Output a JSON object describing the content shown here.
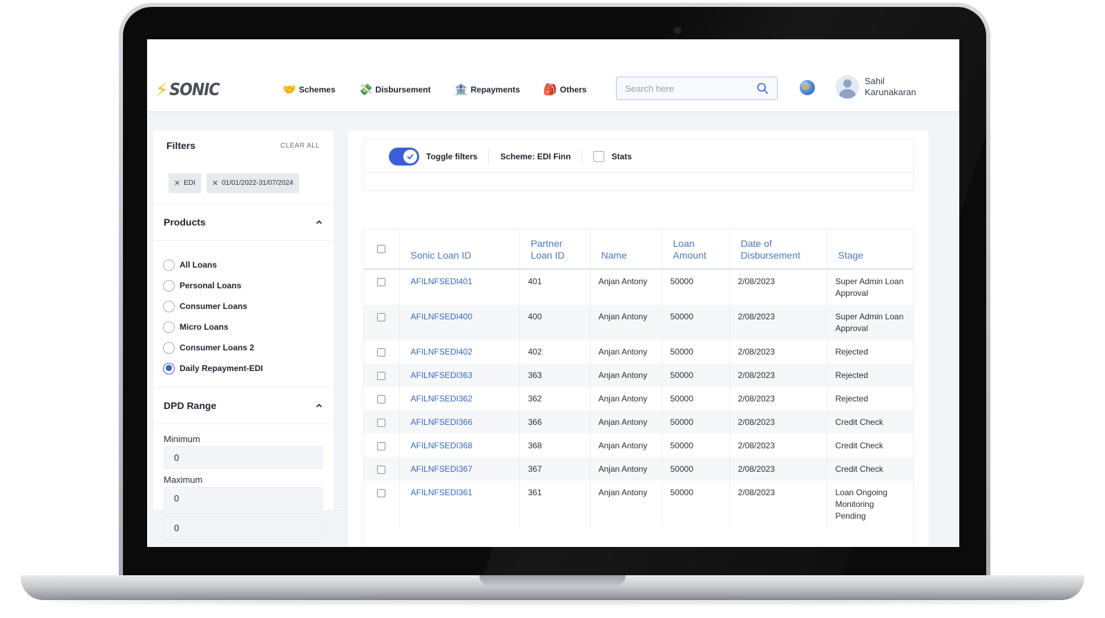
{
  "brand": {
    "name": "SONIC"
  },
  "nav": {
    "items": [
      {
        "emoji": "🤝",
        "label": "Schemes"
      },
      {
        "emoji": "💸",
        "label": "Disbursement"
      },
      {
        "emoji": "🏦",
        "label": "Repayments"
      },
      {
        "emoji": "🎒",
        "label": "Others"
      }
    ]
  },
  "search": {
    "placeholder": "Search here",
    "value": ""
  },
  "user": {
    "name": "Sahil Karunakaran"
  },
  "filters": {
    "title": "Filters",
    "clear_all": "CLEAR ALL",
    "chips": [
      "EDI",
      "01/01/2022-31/07/2024"
    ],
    "products": {
      "title": "Products",
      "options": [
        "All Loans",
        "Personal Loans",
        "Consumer Loans",
        "Micro Loans",
        "Consumer Loans 2",
        "Daily Repayment-EDI"
      ],
      "selected": "Daily Repayment-EDI"
    },
    "dpd_range": {
      "title": "DPD Range",
      "minimum_label": "Minimum",
      "minimum_value": "0",
      "maximum_label": "Maximum",
      "maximum_value": "0",
      "extra_value": "0"
    }
  },
  "toolbar": {
    "toggle_label": "Toggle filters",
    "toggle_on": true,
    "scheme_label": "Scheme: EDI Finn",
    "stats_label": "Stats",
    "stats_checked": false
  },
  "table": {
    "columns": [
      "Sonic Loan ID",
      "Partner Loan ID",
      "Name",
      "Loan Amount",
      "Date of Disbursement",
      "Stage"
    ],
    "rows": [
      {
        "sonic_id": "AFILNFSEDI401",
        "partner_id": "401",
        "name": "Anjan Antony",
        "amount": "50000",
        "date": "2/08/2023",
        "stage": "Super Admin Loan Approval"
      },
      {
        "sonic_id": "AFILNFSEDI400",
        "partner_id": "400",
        "name": "Anjan Antony",
        "amount": "50000",
        "date": "2/08/2023",
        "stage": "Super Admin Loan Approval"
      },
      {
        "sonic_id": "AFILNFSEDI402",
        "partner_id": "402",
        "name": "Anjan Antony",
        "amount": "50000",
        "date": "2/08/2023",
        "stage": "Rejected"
      },
      {
        "sonic_id": "AFILNFSEDI363",
        "partner_id": "363",
        "name": "Anjan Antony",
        "amount": "50000",
        "date": "2/08/2023",
        "stage": "Rejected"
      },
      {
        "sonic_id": "AFILNFSEDI362",
        "partner_id": "362",
        "name": "Anjan Antony",
        "amount": "50000",
        "date": "2/08/2023",
        "stage": "Rejected"
      },
      {
        "sonic_id": "AFILNFSEDI366",
        "partner_id": "366",
        "name": "Anjan Antony",
        "amount": "50000",
        "date": "2/08/2023",
        "stage": "Credit Check"
      },
      {
        "sonic_id": "AFILNFSEDI368",
        "partner_id": "368",
        "name": "Anjan Antony",
        "amount": "50000",
        "date": "2/08/2023",
        "stage": "Credit Check"
      },
      {
        "sonic_id": "AFILNFSEDI367",
        "partner_id": "367",
        "name": "Anjan Antony",
        "amount": "50000",
        "date": "2/08/2023",
        "stage": "Credit Check"
      },
      {
        "sonic_id": "AFILNFSEDI361",
        "partner_id": "361",
        "name": "Anjan Antony",
        "amount": "50000",
        "date": "2/08/2023",
        "stage": "Loan Ongoing Monitoring Pending"
      }
    ]
  },
  "colors": {
    "accent": "#3b5fd9",
    "link": "#3567c0",
    "header_text": "#4a78c2",
    "logo_bolt": "#f5b81b"
  }
}
